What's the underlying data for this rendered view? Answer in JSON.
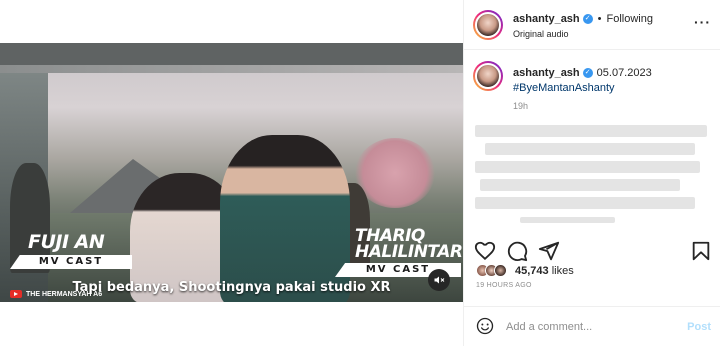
{
  "video": {
    "cast_left_name": "FUJI AN",
    "cast_left_role": "MV CAST",
    "cast_right_name_line1": "THARIQ",
    "cast_right_name_line2": "HALILINTAR",
    "cast_right_role": "MV CAST",
    "subtitle": "Tapi bedanya, Shootingnya pakai studio XR",
    "channel": "THE HERMANSYAH A6",
    "mute_icon": "speaker-muted-icon"
  },
  "header": {
    "username": "ashanty_ash",
    "separator": "•",
    "follow_status": "Following",
    "audio": "Original audio",
    "more_icon": "more-horizontal-icon"
  },
  "caption": {
    "username": "ashanty_ash",
    "date": "05.07.2023",
    "hashtag": "#ByeMantanAshanty",
    "age": "19h"
  },
  "actions": {
    "icons": [
      "heart-icon",
      "comment-icon",
      "share-icon",
      "save-icon"
    ]
  },
  "likes": {
    "count": "45,743",
    "suffix": " likes"
  },
  "post_time": "19 HOURS AGO",
  "comment": {
    "placeholder": "Add a comment...",
    "post_label": "Post"
  },
  "colors": {
    "verified": "#3897f0",
    "hashtag": "#00376b",
    "post_disabled": "#b2dffc",
    "secondary_text": "#8e8e8e"
  }
}
